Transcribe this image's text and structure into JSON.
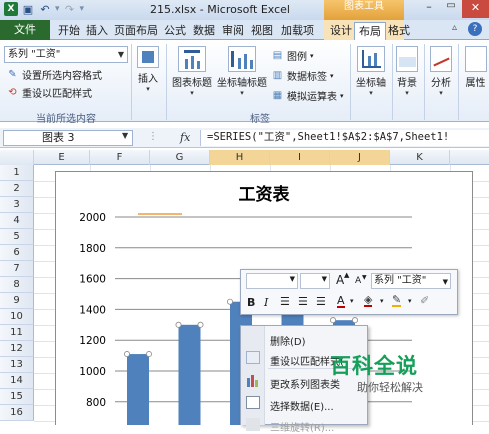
{
  "window": {
    "title": "215.xlsx - Microsoft Excel",
    "context_tab_group": "图表工具",
    "minimize": "–",
    "maximize": "▭",
    "close": "✕"
  },
  "tabs": {
    "file": "文件",
    "items": [
      "开始",
      "插入",
      "页面布局",
      "公式",
      "数据",
      "审阅",
      "视图",
      "加载项",
      "设计",
      "布局",
      "格式"
    ],
    "active": "布局"
  },
  "ribbon": {
    "series_select": "系列 \"工资\"",
    "format_selection": "设置所选内容格式",
    "reset_style": "重设以匹配样式",
    "group_current_selection": "当前所选内容",
    "insert": "插入",
    "chart_title": "图表标题",
    "axis_titles": "坐标轴标题",
    "legend": "图例",
    "data_labels": "数据标签",
    "data_table": "模拟运算表",
    "group_labels": "标签",
    "axes": "坐标轴",
    "background": "背景",
    "analysis": "分析",
    "properties": "属性"
  },
  "formula_bar": {
    "name_box": "图表 3",
    "fx": "fx",
    "formula": "=SERIES(\"工资\",Sheet1!$A$2:$A$7,Sheet1!"
  },
  "grid": {
    "columns": [
      "E",
      "F",
      "G",
      "H",
      "I",
      "J",
      "K"
    ],
    "selected_columns": [
      "H",
      "I",
      "J"
    ],
    "rows": [
      "1",
      "2",
      "3",
      "4",
      "5",
      "6",
      "7",
      "8",
      "9",
      "10",
      "11",
      "12",
      "13",
      "14",
      "15",
      "16"
    ]
  },
  "chart_data": {
    "type": "bar",
    "title": "工资表",
    "ylim": [
      0,
      2000
    ],
    "yticks": [
      "2000",
      "1800",
      "1600",
      "1400",
      "1200",
      "1000",
      "800"
    ],
    "tick_values": [
      2000,
      1800,
      1600,
      1400,
      1200,
      1000,
      800
    ],
    "series": [
      {
        "name": "工资",
        "values": [
          1110,
          1300,
          1450,
          1400,
          1330
        ]
      }
    ],
    "grid": true,
    "color": "#4f81bd"
  },
  "mini_toolbar": {
    "grow_font": "A",
    "shrink_font": "A",
    "series_select": "系列 \"工资\"",
    "bold": "B",
    "italic": "I",
    "font_color": "A"
  },
  "context_menu": {
    "items": [
      {
        "label": "删除(D)",
        "disabled": false
      },
      {
        "label": "重设以匹配样式(",
        "disabled": false
      },
      {
        "label": "更改系列图表类",
        "disabled": false
      },
      {
        "label": "选择数据(E)...",
        "disabled": false
      },
      {
        "label": "三维旋转(R)...",
        "disabled": true
      }
    ]
  },
  "watermark": {
    "main": "百科全说",
    "sub": "助你轻松解决"
  }
}
